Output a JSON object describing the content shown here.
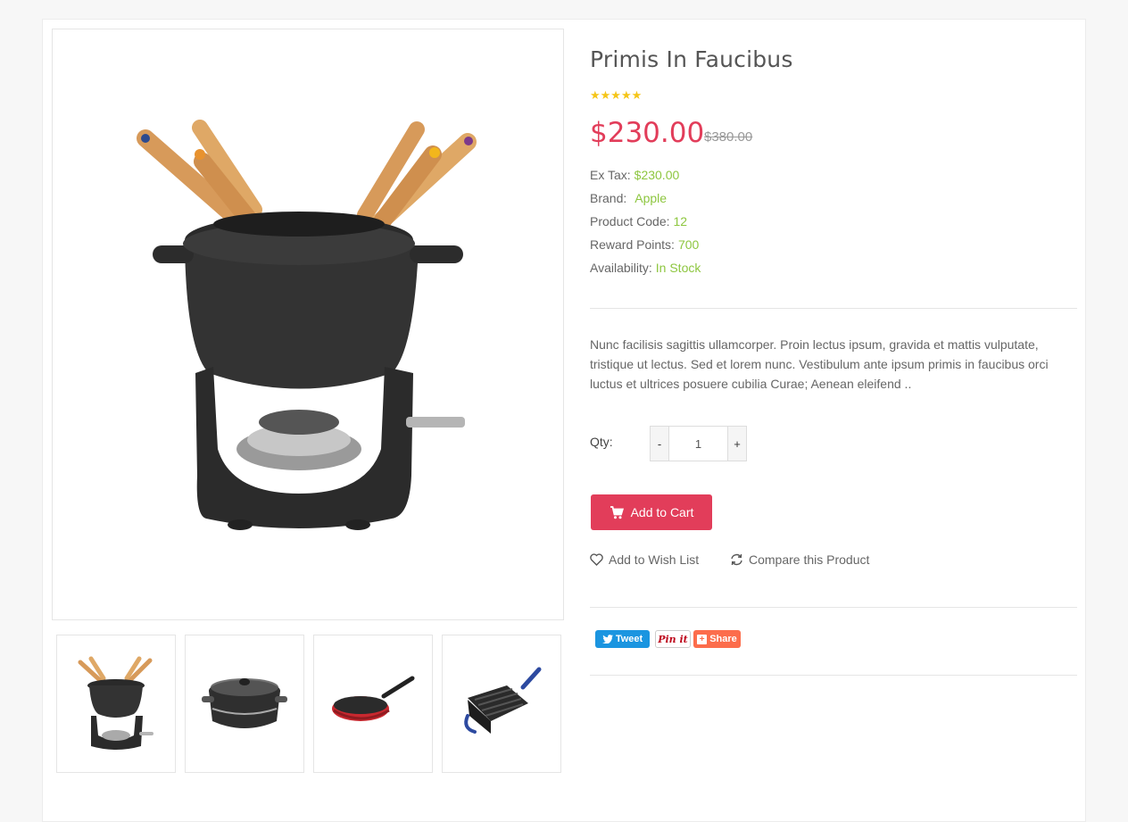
{
  "product": {
    "title": "Primis In Faucibus",
    "rating_stars": "★★★★★",
    "price": "$230.00",
    "old_price": "$380.00",
    "details": [
      {
        "label": "Ex Tax:",
        "value": "$230.00"
      },
      {
        "label": "Brand:",
        "value": "Apple"
      },
      {
        "label": "Product Code:",
        "value": "12"
      },
      {
        "label": "Reward Points:",
        "value": "700"
      },
      {
        "label": "Availability:",
        "value": "In Stock"
      }
    ],
    "description": "Nunc facilisis sagittis ullamcorper. Proin lectus ipsum, gravida et mattis vulputate, tristique ut lectus. Sed et lorem nunc. Vestibulum ante ipsum primis in faucibus orci luctus et ultrices posuere cubilia Curae; Aenean eleifend .."
  },
  "purchase": {
    "qty_label": "Qty:",
    "qty_value": "1",
    "minus": "-",
    "plus": "+",
    "add_to_cart": "Add to Cart",
    "wishlist": "Add to Wish List",
    "compare": "Compare this Product"
  },
  "share": {
    "tweet": "Tweet",
    "pin": "Pin it",
    "share": "Share"
  },
  "colors": {
    "accent": "#e23d5a",
    "value_green": "#8dc63f",
    "star": "#f5c518",
    "twitter": "#1b95e0",
    "share_orange": "#fc6d4c"
  }
}
